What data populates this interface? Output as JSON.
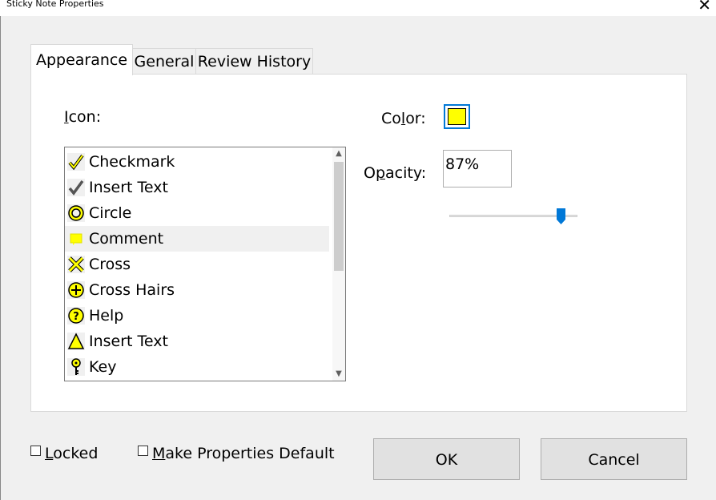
{
  "window": {
    "title": "Sticky Note Properties",
    "close_glyph": "✕"
  },
  "tabs": [
    {
      "label": "Appearance",
      "active": true
    },
    {
      "label": "General",
      "active": false
    },
    {
      "label": "Review History",
      "active": false
    }
  ],
  "appearance": {
    "icon_label": "Icon:",
    "icon_label_pre": "",
    "icon_label_u": "I",
    "icon_label_post": "con:",
    "icons": [
      {
        "label": "Checkmark",
        "icon": "checkmark-icon"
      },
      {
        "label": "Insert Text",
        "icon": "checkmark-gray-icon"
      },
      {
        "label": "Circle",
        "icon": "circle-icon"
      },
      {
        "label": "Comment",
        "icon": "comment-icon",
        "selected": true
      },
      {
        "label": "Cross",
        "icon": "cross-icon"
      },
      {
        "label": "Cross Hairs",
        "icon": "crosshairs-icon"
      },
      {
        "label": "Help",
        "icon": "help-icon"
      },
      {
        "label": "Insert Text",
        "icon": "insert-triangle-icon"
      },
      {
        "label": "Key",
        "icon": "key-icon"
      }
    ],
    "color_label_pre": "Co",
    "color_label_u": "l",
    "color_label_post": "or:",
    "color_value": "#ffff00",
    "opacity_label_pre": "O",
    "opacity_label_u": "p",
    "opacity_label_post": "acity:",
    "opacity_value": "87%",
    "opacity_fraction": 0.87
  },
  "footer": {
    "locked_u": "L",
    "locked_rest": "ocked",
    "locked_checked": false,
    "default_u": "M",
    "default_rest": "ake Properties Default",
    "default_checked": false,
    "ok_label": "OK",
    "cancel_label": "Cancel"
  },
  "colors": {
    "accent": "#0078d7",
    "icon_fill": "#ffff00"
  }
}
